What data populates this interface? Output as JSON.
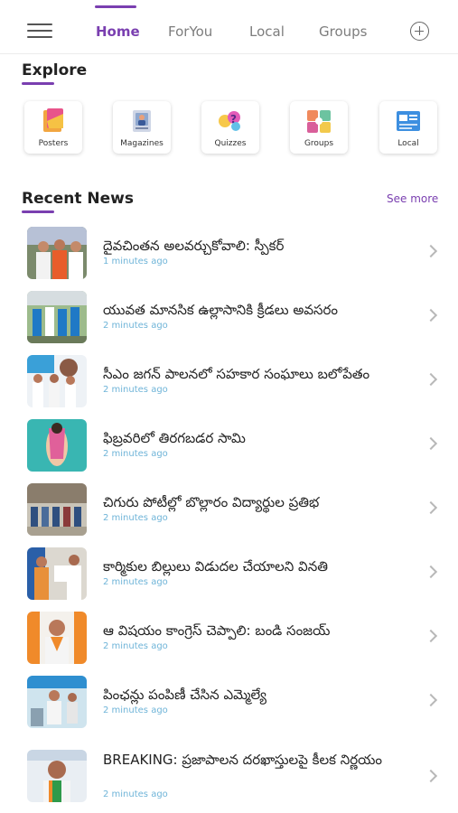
{
  "nav": {
    "tabs": [
      {
        "label": "Home",
        "active": true
      },
      {
        "label": "ForYou",
        "active": false
      },
      {
        "label": "Local",
        "active": false
      },
      {
        "label": "Groups",
        "active": false
      }
    ],
    "accent_color": "#7a3fb0",
    "menu_icon": "hamburger-menu-icon",
    "add_icon": "plus-circle-icon"
  },
  "explore": {
    "title": "Explore",
    "items": [
      {
        "label": "Posters",
        "icon": "posters-icon"
      },
      {
        "label": "Magazines",
        "icon": "magazines-icon"
      },
      {
        "label": "Quizzes",
        "icon": "quizzes-icon"
      },
      {
        "label": "Groups",
        "icon": "groups-icon"
      },
      {
        "label": "Local",
        "icon": "local-news-icon"
      }
    ]
  },
  "recent_news": {
    "title": "Recent News",
    "see_more": "See more",
    "items": [
      {
        "title": "దైవచింతన అలవర్చుకోవాలి: స్పీకర్",
        "time": "1 minutes ago"
      },
      {
        "title": "యువత మానసిక ఉల్లాసానికి క్రీడలు అవసరం",
        "time": "2 minutes ago"
      },
      {
        "title": "సీఎం జగన్ పాలనలో సహకార సంఘాలు బలోపేతం",
        "time": "2 minutes ago"
      },
      {
        "title": "ఫిబ్రవరిలో తిరగబడర సామి",
        "time": "2 minutes ago"
      },
      {
        "title": "చిగురు పోటీల్లో బొల్లారం విద్యార్థుల ప్రతిభ",
        "time": "2 minutes ago"
      },
      {
        "title": "కార్మికుల బిల్లులు విడుదల చేయాలని వినతి",
        "time": "2 minutes ago"
      },
      {
        "title": "ఆ విషయం కాంగ్రెస్ చెప్పాలి: బండి సంజయ్",
        "time": "2 minutes ago"
      },
      {
        "title": "పింఛన్లు పంపిణీ చేసిన ఎమ్మెల్యే",
        "time": "2 minutes ago"
      },
      {
        "title": "BREAKING: ప్రజాపాలన దరఖాస్తులపై కీలక నిర్ణయం",
        "time": "2 minutes ago"
      }
    ]
  }
}
